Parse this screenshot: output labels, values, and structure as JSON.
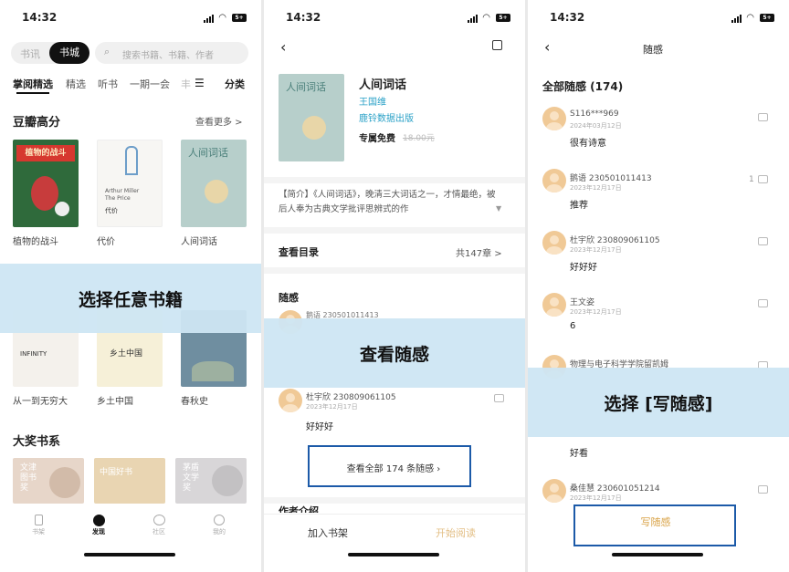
{
  "status": {
    "time": "14:32",
    "battery": "5+"
  },
  "p1": {
    "tabs": [
      "书讯",
      "书城"
    ],
    "search_placeholder": "搜索书籍、书籍、作者",
    "nav": [
      "掌阅精选",
      "精选",
      "听书",
      "一期一会",
      "丰"
    ],
    "nav_category": "分类",
    "section1_title": "豆瓣高分",
    "see_more": "查看更多 >",
    "books": [
      "植物的战斗",
      "代价",
      "人间词话"
    ],
    "cover_texts": {
      "b1": "植物的战斗",
      "b2_line1": "Arthur Miller",
      "b2_line2": "The Price",
      "b2_line3": "代价",
      "b3": "人间词话",
      "r2a": "INFINITY",
      "r2b": "乡土中国"
    },
    "books_row2": [
      "从一到无穷大",
      "乡土中国",
      "春秋史"
    ],
    "overlay": "选择任意书籍",
    "section2_title": "大奖书系",
    "awards": [
      "文津图书奖",
      "中国好书",
      "茅盾文学奖"
    ],
    "bottom_nav": [
      "书架",
      "发现",
      "社区",
      "我的"
    ]
  },
  "p2": {
    "book_title": "人间词话",
    "author": "王国维",
    "publisher": "鹿铃数据出版",
    "price_label": "专属免费",
    "price_old": "18.00元",
    "intro": "【简介】《人间词话》，晚清三大词话之一，才情最绝，被后人奉为古典文学批评思辨式的作",
    "catalog": "查看目录",
    "chapters": "共147章 >",
    "notes_title": "随感",
    "partial_user": "鹅语 230501011413",
    "overlay": "查看随感",
    "note_user": "杜宇欣 230809061105",
    "note_date": "2023年12月17日",
    "note_text": "好好好",
    "view_all": "查看全部 174 条随感",
    "author_section": "作者介绍",
    "add_shelf": "加入书架",
    "start_read": "开始阅读"
  },
  "p3": {
    "title": "随感",
    "all_notes": "全部随感 (174)",
    "notes": [
      {
        "user": "S116***969",
        "date": "2024年03月12日",
        "text": "很有诗意",
        "likes": ""
      },
      {
        "user": "鹅语 230501011413",
        "date": "2023年12月17日",
        "text": "推荐",
        "likes": "1"
      },
      {
        "user": "杜宇欣 230809061105",
        "date": "2023年12月17日",
        "text": "好好好",
        "likes": ""
      },
      {
        "user": "王文姿",
        "date": "2023年12月17日",
        "text": "6",
        "likes": ""
      },
      {
        "user": "物理与电子科学学院留凯姆",
        "date": "",
        "text": "",
        "likes": ""
      },
      {
        "user": "",
        "date": "",
        "text": "好看",
        "likes": ""
      },
      {
        "user": "桑佳慧 230601051214",
        "date": "2023年12月17日",
        "text": "",
        "likes": ""
      }
    ],
    "overlay": "选择 [写随感]",
    "write": "写随感"
  },
  "colors": {
    "overlay": "#cde6f3",
    "highlight_border": "#1c5aa8",
    "accent_gold": "#d9a347",
    "link_blue": "#2aa1c7"
  }
}
